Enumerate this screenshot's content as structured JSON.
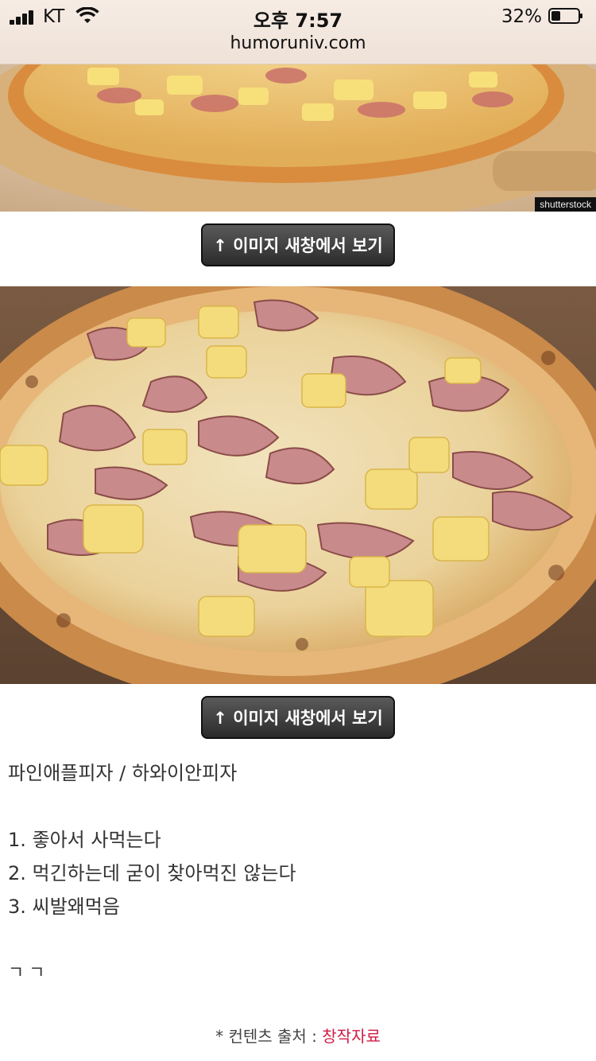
{
  "status_bar": {
    "carrier": "KT",
    "time": "오후 7:57",
    "battery": "32%"
  },
  "address_bar": {
    "url": "humoruniv.com"
  },
  "images": {
    "top": {
      "watermark": "shutterstock"
    }
  },
  "buttons": {
    "open_image_1": "↑ 이미지 새창에서 보기",
    "open_image_2": "↑ 이미지 새창에서 보기"
  },
  "post": {
    "title": "파인애플피자 / 하와이안피자",
    "options": [
      "1. 좋아서 사먹는다",
      "2. 먹긴하는데 굳이 찾아먹진 않는다",
      "3. 씨발왜먹음"
    ],
    "footer_text": "ㄱㄱ"
  },
  "source": {
    "prefix": "* 컨텐츠 출처 : ",
    "link": "창작자료"
  },
  "colors": {
    "link": "#d21b45",
    "button_bg": "#3a3a3a"
  }
}
